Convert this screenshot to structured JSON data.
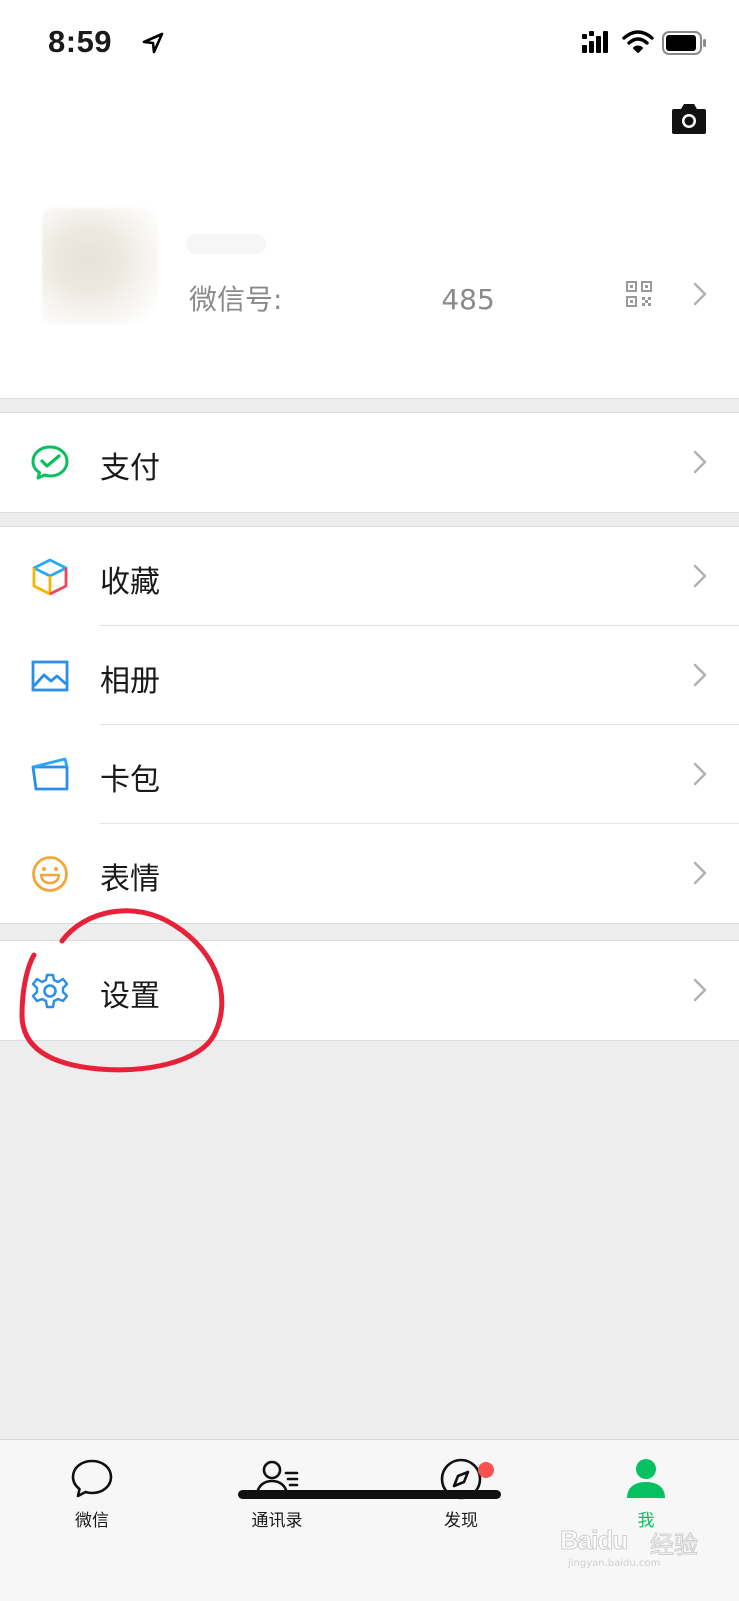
{
  "status_bar": {
    "time": "8:59"
  },
  "profile": {
    "wechat_id_label": "微信号: ",
    "wechat_id_visible_suffix": "485"
  },
  "menu": {
    "pay": "支付",
    "favorites": "收藏",
    "album": "相册",
    "cards": "卡包",
    "stickers": "表情",
    "settings": "设置"
  },
  "tab_bar": {
    "tabs": [
      {
        "label": "微信",
        "icon": "chat-bubble-icon"
      },
      {
        "label": "通讯录",
        "icon": "contacts-icon"
      },
      {
        "label": "发现",
        "icon": "compass-icon",
        "badge": true
      },
      {
        "label": "我",
        "icon": "person-icon",
        "active": true
      }
    ]
  },
  "colors": {
    "accent": "#07c160",
    "badge": "#fa5151",
    "annotation": "#e8213a"
  },
  "watermark": {
    "brand": "Baidu",
    "cn": "经验",
    "url": "jingyan.baidu.com"
  }
}
